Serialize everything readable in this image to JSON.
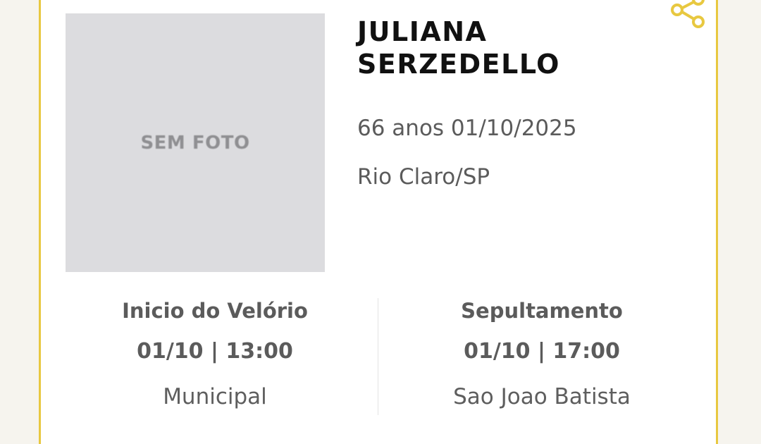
{
  "colors": {
    "page_background": "#f6f4ee",
    "card_background": "#ffffff",
    "accent": "#e8c840",
    "photo_placeholder": "#dcdcdf",
    "text_primary": "#111111",
    "text_secondary": "#5b5b5b"
  },
  "photo": {
    "placeholder_text": "SEM FOTO"
  },
  "person": {
    "name_line1": "JULIANA",
    "name_line2": "SERZEDELLO",
    "age_and_date": "66 anos 01/10/2025",
    "city": "Rio Claro/SP"
  },
  "share": {
    "icon": "share-icon"
  },
  "wake": {
    "title": "Inicio do Velório",
    "datetime": "01/10 | 13:00",
    "place": "Municipal"
  },
  "burial": {
    "title": "Sepultamento",
    "datetime": "01/10 | 17:00",
    "place": "Sao Joao Batista"
  }
}
